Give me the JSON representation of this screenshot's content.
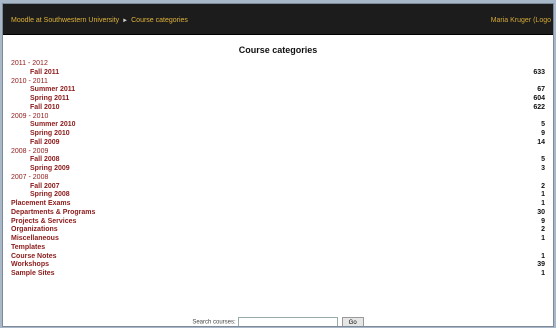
{
  "breadcrumb": {
    "home": "Moodle at Southwestern University",
    "separator": "►",
    "current": "Course categories"
  },
  "login_text": "Maria Kruger (Logo",
  "title": "Course categories",
  "categories": [
    {
      "name": "2011 - 2012",
      "count": "",
      "level": "top"
    },
    {
      "name": "Fall 2011",
      "count": "633",
      "level": "sub"
    },
    {
      "name": "2010 - 2011",
      "count": "",
      "level": "top"
    },
    {
      "name": "Summer 2011",
      "count": "67",
      "level": "sub"
    },
    {
      "name": "Spring 2011",
      "count": "604",
      "level": "sub"
    },
    {
      "name": "Fall 2010",
      "count": "622",
      "level": "sub"
    },
    {
      "name": "2009 - 2010",
      "count": "",
      "level": "top"
    },
    {
      "name": "Summer 2010",
      "count": "5",
      "level": "sub"
    },
    {
      "name": "Spring 2010",
      "count": "9",
      "level": "sub"
    },
    {
      "name": "Fall 2009",
      "count": "14",
      "level": "sub"
    },
    {
      "name": "2008 - 2009",
      "count": "",
      "level": "top"
    },
    {
      "name": "Fall 2008",
      "count": "5",
      "level": "sub"
    },
    {
      "name": "Spring 2009",
      "count": "3",
      "level": "sub"
    },
    {
      "name": "2007 - 2008",
      "count": "",
      "level": "top"
    },
    {
      "name": "Fall 2007",
      "count": "2",
      "level": "sub"
    },
    {
      "name": "Spring 2008",
      "count": "1",
      "level": "sub"
    },
    {
      "name": "Placement Exams",
      "count": "1",
      "level": "top-strong"
    },
    {
      "name": "Departments & Programs",
      "count": "30",
      "level": "top-strong"
    },
    {
      "name": "Projects & Services",
      "count": "9",
      "level": "top-strong"
    },
    {
      "name": "Organizations",
      "count": "2",
      "level": "top-strong"
    },
    {
      "name": "Miscellaneous",
      "count": "1",
      "level": "top-strong"
    },
    {
      "name": "Templates",
      "count": "",
      "level": "top-strong"
    },
    {
      "name": "Course Notes",
      "count": "1",
      "level": "top-strong"
    },
    {
      "name": "Workshops",
      "count": "39",
      "level": "top-strong"
    },
    {
      "name": "Sample Sites",
      "count": "1",
      "level": "top-strong"
    }
  ],
  "search": {
    "label": "Search courses:",
    "value": "",
    "button": "Go"
  },
  "colors": {
    "link": "#8c1a1a",
    "topbar": "#1c1c1c",
    "breadcrumb": "#e0b33a"
  }
}
